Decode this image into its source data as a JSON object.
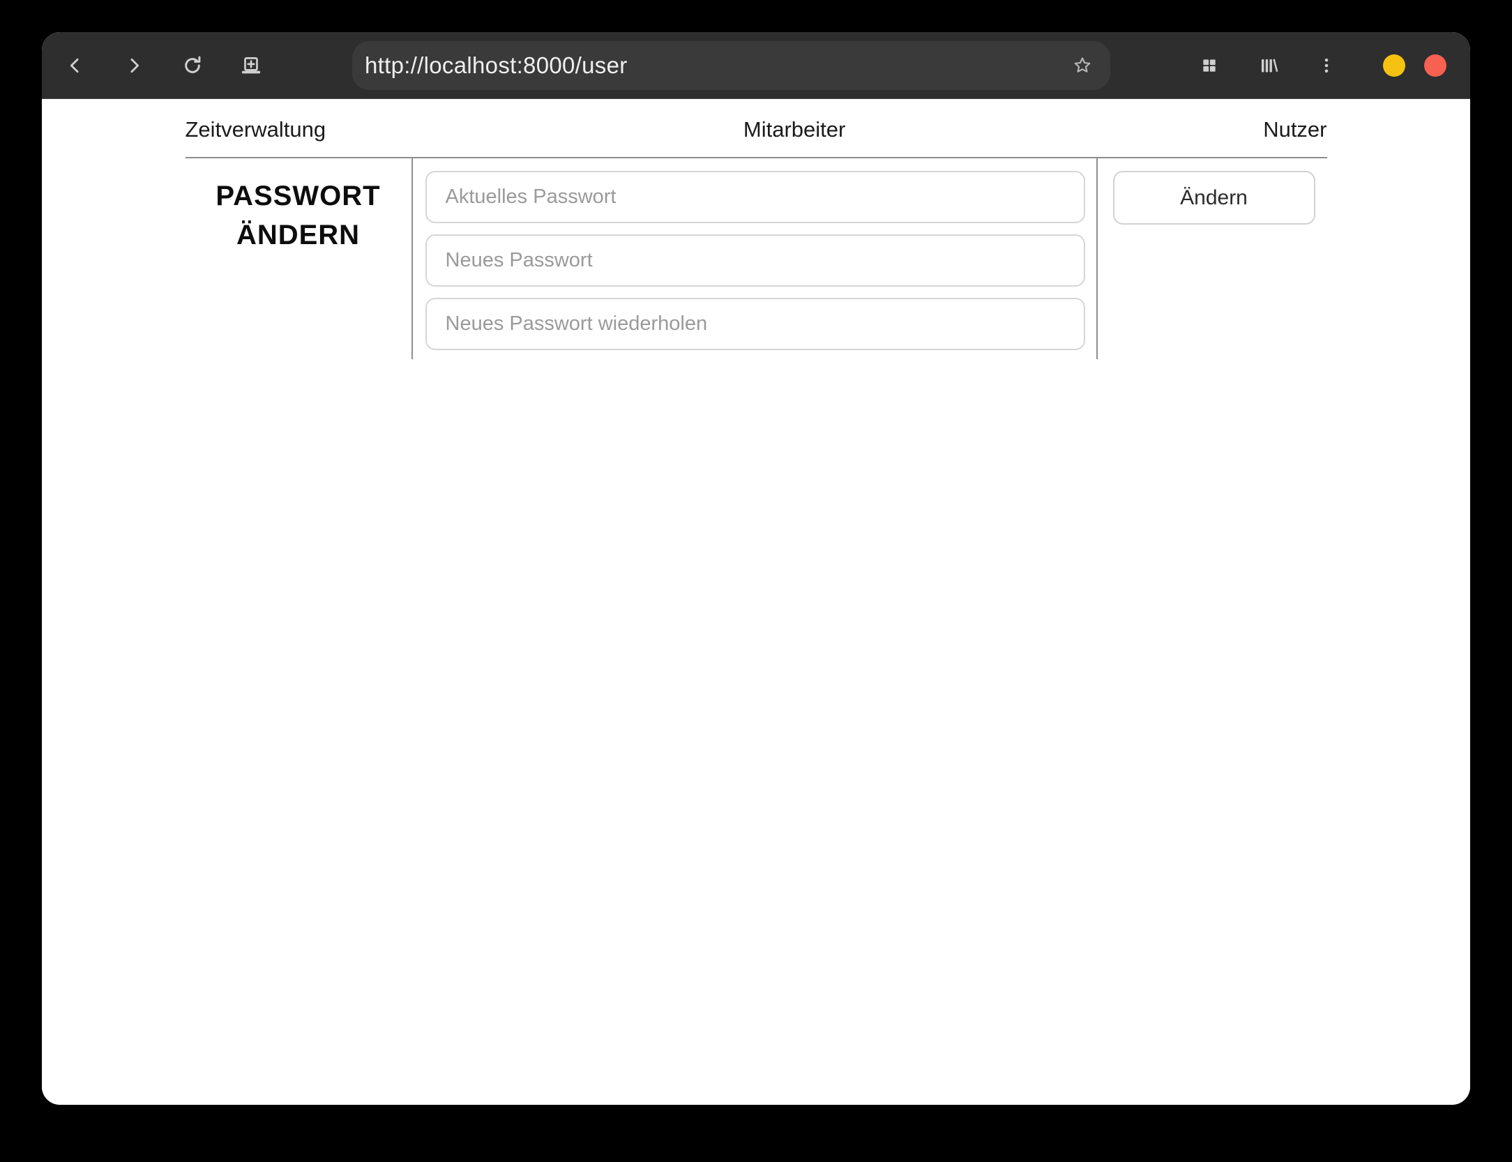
{
  "browser": {
    "url": "http://localhost:8000/user",
    "toolbar_icons": {
      "back": "back-chevron-icon",
      "forward": "forward-chevron-icon",
      "reload": "reload-icon",
      "new_tab": "new-tab-icon",
      "bookmark": "star-icon",
      "tab_overview": "grid-icon",
      "library": "library-icon",
      "menu": "kebab-menu-icon"
    },
    "window_controls": {
      "minimize_color": "#f5c211",
      "close_color": "#f66151"
    },
    "colors": {
      "toolbar_bg": "#2e2e2e",
      "urlbar_bg": "#3a3a3a",
      "icon_gray": "#cfcfcf"
    }
  },
  "nav": {
    "items": [
      {
        "label": "Zeitverwaltung"
      },
      {
        "label": "Mitarbeiter"
      },
      {
        "label": "Nutzer"
      }
    ]
  },
  "password_section": {
    "heading_lines": [
      "PASSWORT",
      "ÄNDERN"
    ],
    "fields": [
      {
        "placeholder": "Aktuelles Passwort",
        "value": ""
      },
      {
        "placeholder": "Neues Passwort",
        "value": ""
      },
      {
        "placeholder": "Neues Passwort wiederholen",
        "value": ""
      }
    ],
    "submit_label": "Ändern"
  }
}
